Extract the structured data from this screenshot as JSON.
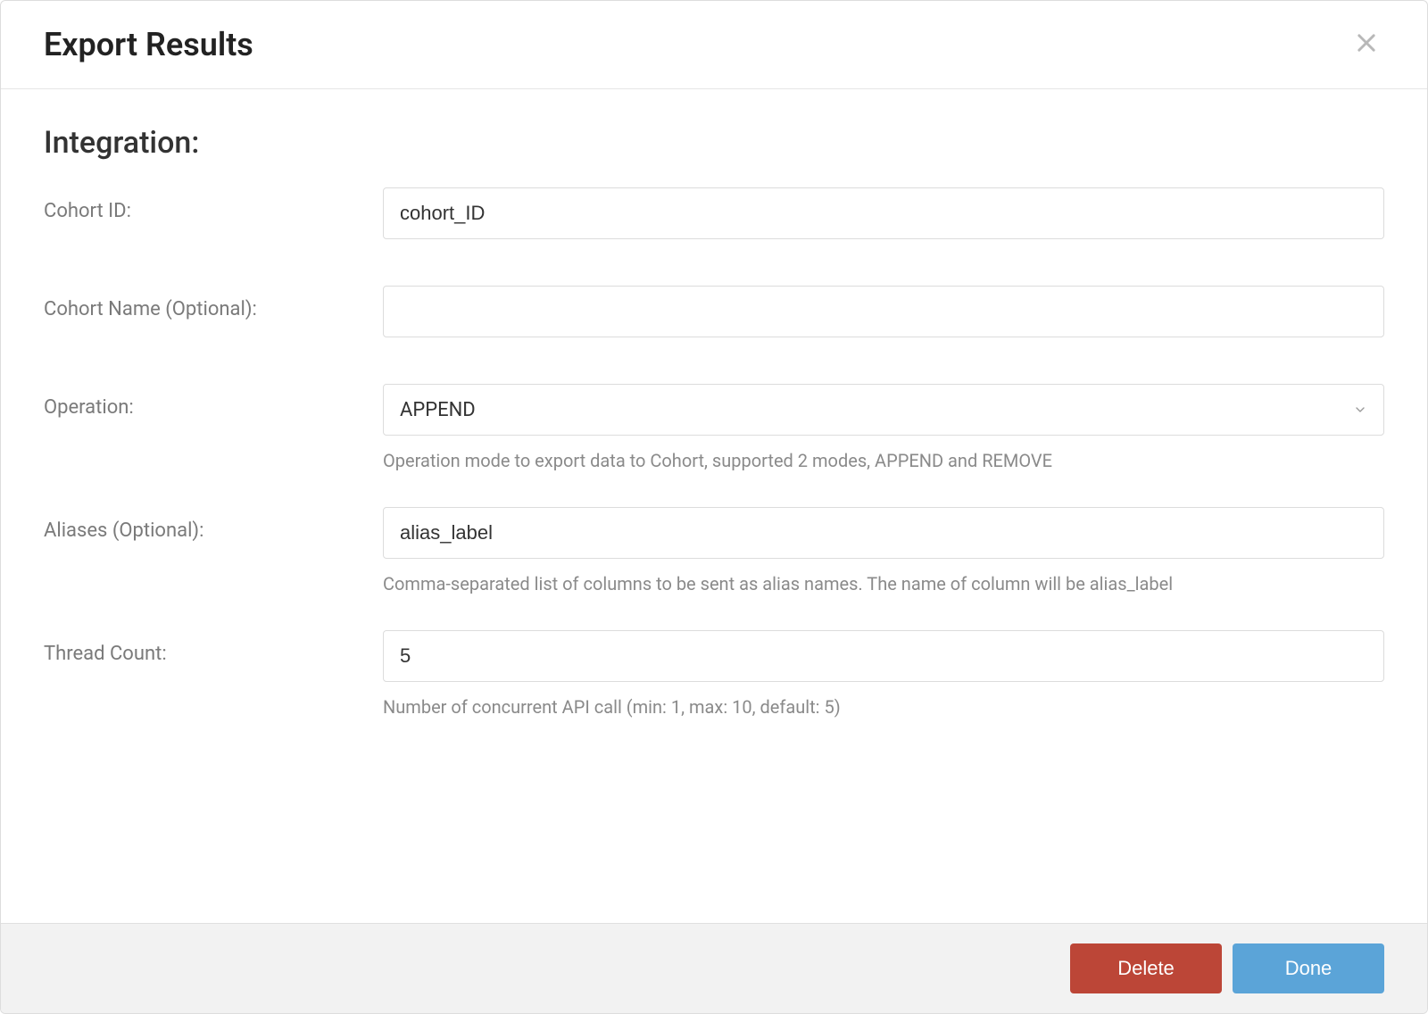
{
  "modal": {
    "title": "Export Results"
  },
  "section": {
    "title": "Integration:"
  },
  "fields": {
    "cohort_id": {
      "label": "Cohort ID:",
      "value": "cohort_ID"
    },
    "cohort_name": {
      "label": "Cohort Name (Optional):",
      "value": ""
    },
    "operation": {
      "label": "Operation:",
      "value": "APPEND",
      "help": "Operation mode to export data to Cohort, supported 2 modes, APPEND and REMOVE"
    },
    "aliases": {
      "label": "Aliases (Optional):",
      "value": "alias_label",
      "help": "Comma-separated list of columns to be sent as alias names. The name of column will be alias_label"
    },
    "thread_count": {
      "label": "Thread Count:",
      "value": "5",
      "help": "Number of concurrent API call (min: 1, max: 10, default: 5)"
    }
  },
  "footer": {
    "delete_label": "Delete",
    "done_label": "Done"
  }
}
